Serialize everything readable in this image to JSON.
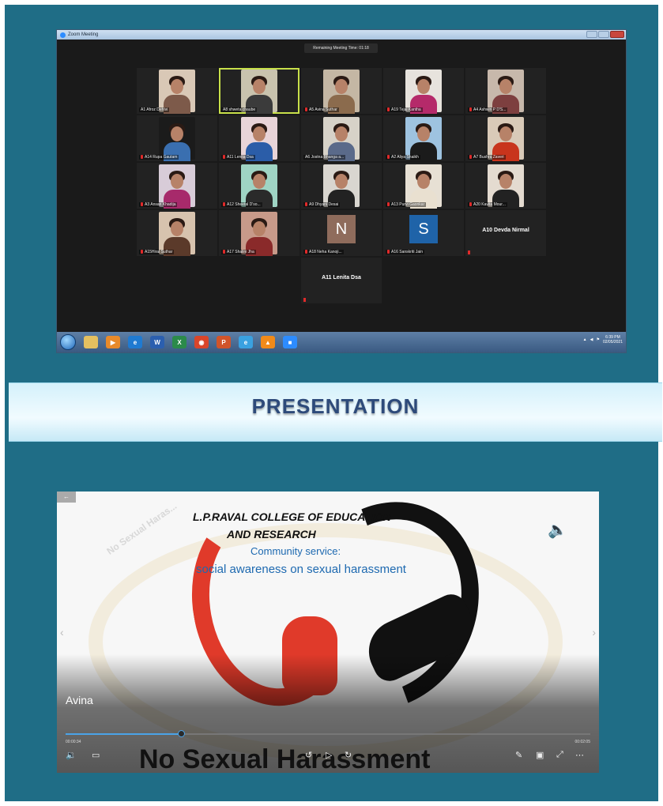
{
  "zoom": {
    "window_title": "Zoom Meeting",
    "remaining_time": "Remaining Meeting Time: 01:18",
    "participants": [
      {
        "name": "A1 Afroz Dehlvi",
        "mic": false,
        "bg": "#d9c8b6",
        "shirt": "#7d5a4a"
      },
      {
        "name": "A8 shweta chaube",
        "mic": false,
        "bg": "#c9c3ae",
        "shirt": "#3b3b3b",
        "active": true
      },
      {
        "name": "A5 Avina Suthar",
        "mic": true,
        "bg": "#c4b7a4",
        "shirt": "#8b6b4d"
      },
      {
        "name": "A19 Tejal Kantha",
        "mic": true,
        "bg": "#e7e3dd",
        "shirt": "#b52a6a"
      },
      {
        "name": "A4 Ashwin P D'S...",
        "mic": true,
        "bg": "#c7b8ab",
        "shirt": "#7d3f3f"
      },
      {
        "name": "A14 Rupa Gautam",
        "mic": true,
        "bg": "#1b1b1b",
        "shirt": "#3a6fb0"
      },
      {
        "name": "A11 Lenita Dsa",
        "mic": true,
        "bg": "#e8d4d8",
        "shirt": "#2b5da8"
      },
      {
        "name": "A6 Jostna Bhanga a...",
        "mic": false,
        "bg": "#d7d2c8",
        "shirt": "#5a6a8a"
      },
      {
        "name": "A2 Aliya Shaikh",
        "mic": true,
        "bg": "#9ec3e0",
        "shirt": "#1b1b1b"
      },
      {
        "name": "A7 Bushra Zaveri",
        "mic": true,
        "bg": "#d9cab8",
        "shirt": "#c8341c"
      },
      {
        "name": "A3 Ansari Khadija",
        "mic": true,
        "bg": "#d8ccd8",
        "shirt": "#a72a6b"
      },
      {
        "name": "A12 Sheetal D'so...",
        "mic": true,
        "bg": "#9fd4c4",
        "shirt": "#2a2a2a"
      },
      {
        "name": "A9 Dhyani Desai",
        "mic": true,
        "bg": "#d9d6d0",
        "shirt": "#222222"
      },
      {
        "name": "A13 Purvi Gaonkar",
        "mic": true,
        "bg": "#e7e0d4",
        "shirt": "#e9e0d0"
      },
      {
        "name": "A20 Kavita Mour...",
        "mic": true,
        "bg": "#e4dbd0",
        "shirt": "#222222"
      },
      {
        "name": "A15Hiral Suthar",
        "mic": true,
        "bg": "#d7c3ae",
        "shirt": "#5b3a2a"
      },
      {
        "name": "A17 Shalini Jha",
        "mic": true,
        "bg": "#c79a8a",
        "shirt": "#8a2a2a"
      },
      {
        "name": "A18 Neha Kanoji...",
        "mic": true,
        "avatar": "N",
        "avatar_bg": "#8f6c5c"
      },
      {
        "name": "A16 Sanskriti Jain",
        "mic": true,
        "avatar": "S",
        "avatar_bg": "#1f63a8"
      },
      {
        "name": "A10 Devda Nirmal",
        "mic": true,
        "name_only": true
      },
      {
        "name": "A11 Lenita Dsa",
        "mic": true,
        "name_only": true
      }
    ],
    "taskbar_icons": [
      {
        "icon": "windows-explorer-icon",
        "bg": "#e4c060",
        "glyph": ""
      },
      {
        "icon": "media-player-icon",
        "bg": "#e88a2a",
        "glyph": "▶"
      },
      {
        "icon": "edge-icon",
        "bg": "#1f7ad1",
        "glyph": "e"
      },
      {
        "icon": "word-icon",
        "bg": "#2b5faf",
        "glyph": "W"
      },
      {
        "icon": "excel-icon",
        "bg": "#2b8a4a",
        "glyph": "X"
      },
      {
        "icon": "chrome-icon",
        "bg": "#d9452a",
        "glyph": "◉"
      },
      {
        "icon": "powerpoint-icon",
        "bg": "#d1542a",
        "glyph": "P"
      },
      {
        "icon": "internet-explorer-icon",
        "bg": "#3aa1e0",
        "glyph": "e"
      },
      {
        "icon": "vlc-icon",
        "bg": "#f08a1a",
        "glyph": "▲"
      },
      {
        "icon": "zoom-app-icon",
        "bg": "#2d8cff",
        "glyph": "■"
      }
    ],
    "clock_time": "6:39 PM",
    "clock_date": "02/05/2021"
  },
  "banner": {
    "title": "PRESENTATION"
  },
  "presentation": {
    "slide_title_line1": "L.P.RAVAL COLLEGE OF EDUCATION",
    "slide_title_line2": "AND RESEARCH",
    "slide_subtitle_line1": "Community service:",
    "slide_subtitle_line2": "social awareness on sexual harassment",
    "watermark": "No Sexual Haras...",
    "presenter_name": "Avina",
    "bottom_title": "No Sexual Harassment",
    "time_elapsed": "00:00:34",
    "time_total": "00:02:05",
    "progress_fraction": 0.22
  }
}
